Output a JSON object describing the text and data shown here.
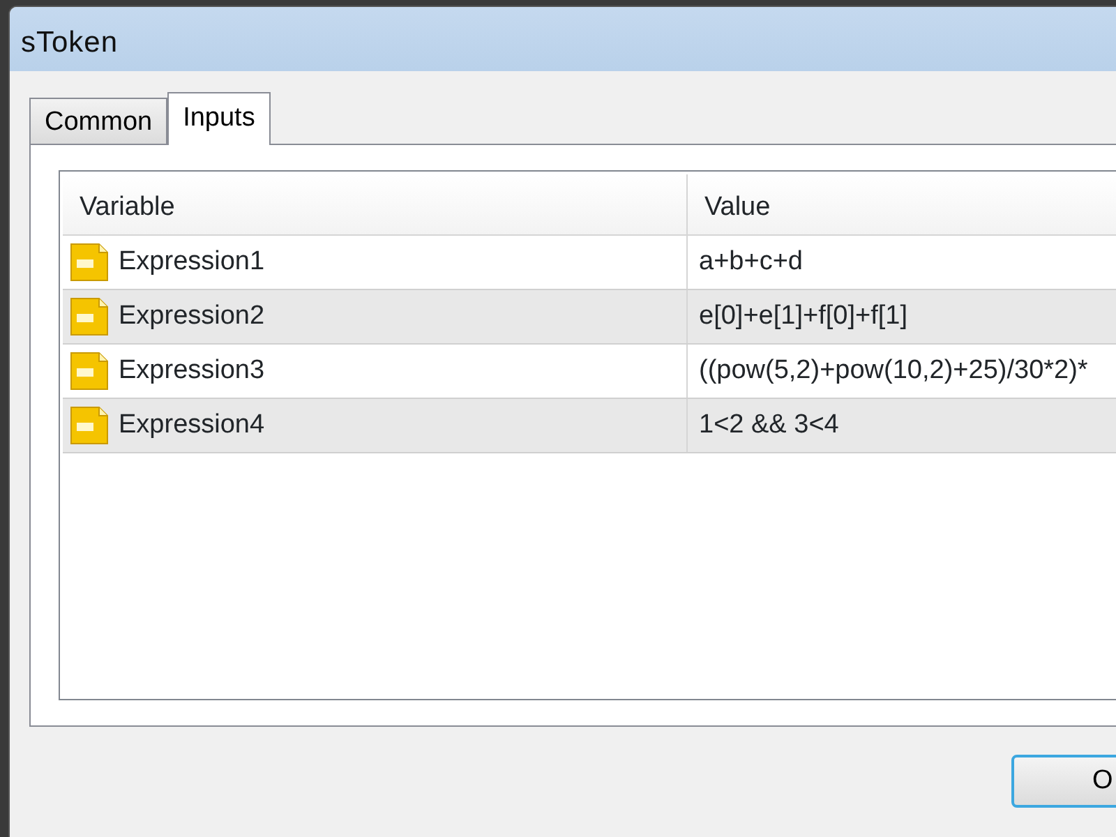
{
  "window": {
    "title": "sToken"
  },
  "tabs": [
    {
      "label": "Common",
      "selected": false
    },
    {
      "label": "Inputs",
      "selected": true
    }
  ],
  "table": {
    "columns": [
      "Variable",
      "Value"
    ],
    "rows": [
      {
        "variable": "Expression1",
        "value": "a+b+c+d"
      },
      {
        "variable": "Expression2",
        "value": "e[0]+e[1]+f[0]+f[1]"
      },
      {
        "variable": "Expression3",
        "value": "((pow(5,2)+pow(10,2)+25)/30*2)*"
      },
      {
        "variable": "Expression4",
        "value": "1<2 && 3<4"
      }
    ]
  },
  "buttons": [
    "O"
  ]
}
